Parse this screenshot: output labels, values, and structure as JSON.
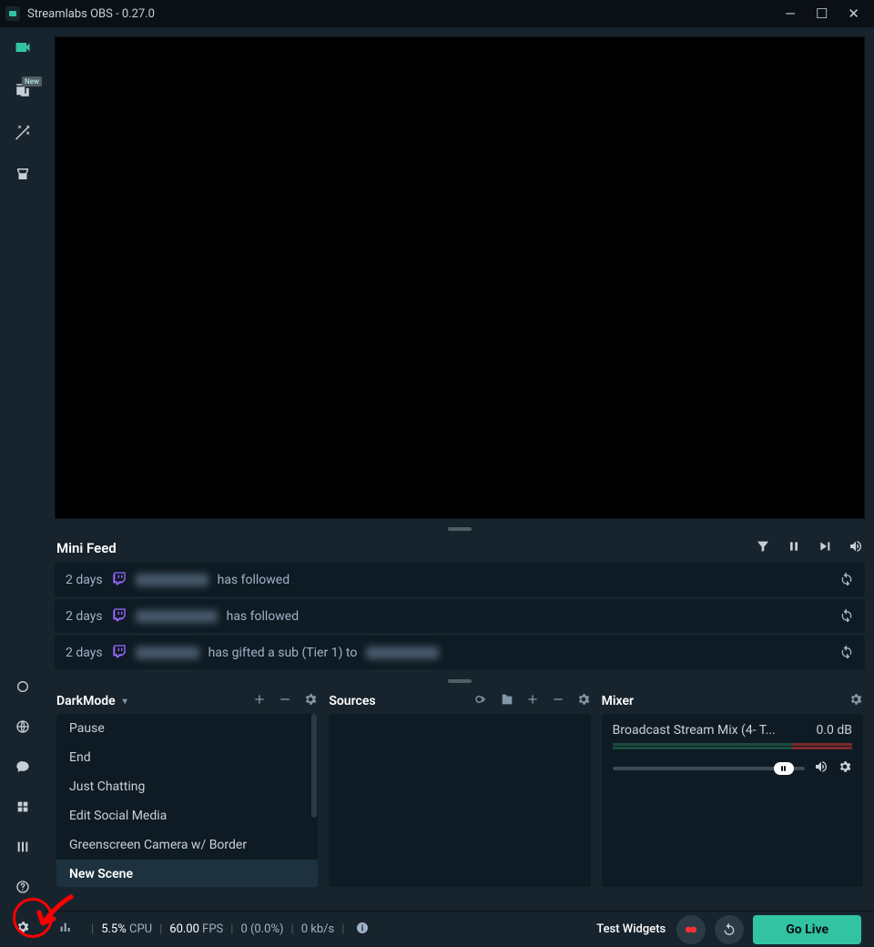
{
  "window": {
    "title": "Streamlabs OBS - 0.27.0"
  },
  "sidebar": {
    "new_badge": "New"
  },
  "minifeed": {
    "title": "Mini Feed",
    "items": [
      {
        "time": "2 days",
        "text": "has followed"
      },
      {
        "time": "2 days",
        "text": "has followed"
      },
      {
        "time": "2 days",
        "text": "has gifted a sub (Tier 1) to"
      }
    ]
  },
  "scenes": {
    "collection": "DarkMode",
    "items": [
      "Pause",
      "End",
      "Just Chatting",
      "Edit Social Media",
      "Greenscreen Camera w/ Border",
      "New Scene"
    ],
    "active_index": 5
  },
  "sources": {
    "title": "Sources"
  },
  "mixer": {
    "title": "Mixer",
    "item_name": "Broadcast Stream Mix (4- T...",
    "db": "0.0 dB"
  },
  "footer": {
    "cpu_value": "5.5%",
    "cpu_label": "CPU",
    "fps_value": "60.00",
    "fps_label": "FPS",
    "dropped": "0 (0.0%)",
    "bitrate": "0 kb/s",
    "test_widgets": "Test Widgets",
    "go_live": "Go Live"
  }
}
